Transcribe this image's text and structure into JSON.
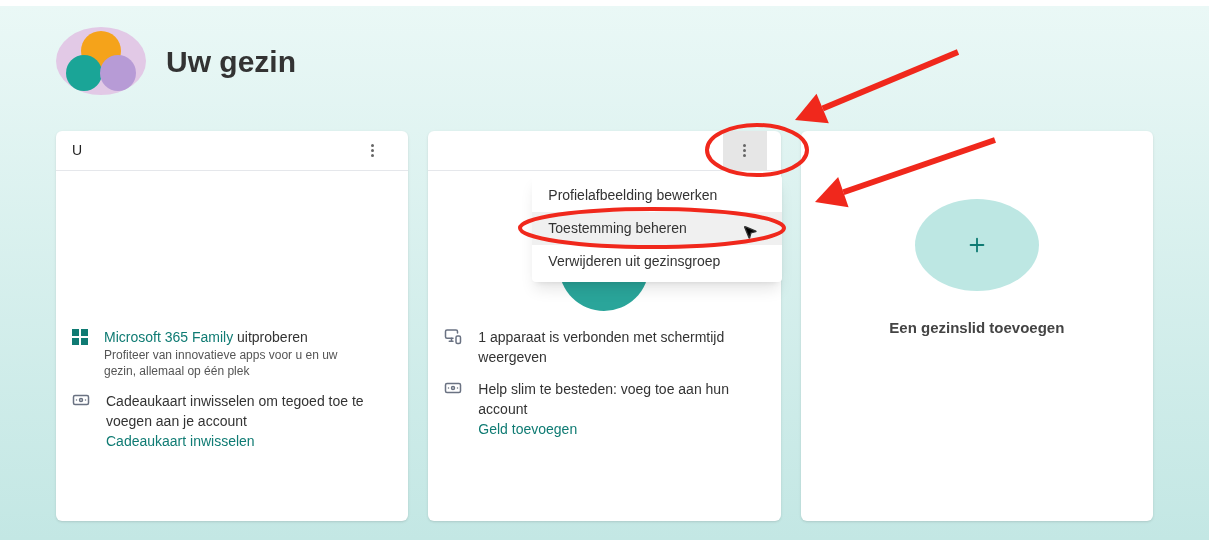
{
  "title": "Uw gezin",
  "cards": [
    {
      "kind": "member",
      "name": "U",
      "menu_active": false,
      "avatar": false,
      "items": [
        {
          "kind": "apps",
          "link": "Microsoft 365 Family",
          "text": " uitproberen",
          "description": "Profiteer van innovatieve apps voor u en uw gezin, allemaal op één plek"
        },
        {
          "kind": "gift",
          "text": "Cadeaukaart inwisselen om tegoed toe te voegen aan je account",
          "action": "Cadeaukaart inwisselen"
        }
      ]
    },
    {
      "kind": "member",
      "menu_active": true,
      "avatar": true,
      "items": [
        {
          "kind": "device",
          "text": "1 apparaat is verbonden met schermtijd weergeven"
        },
        {
          "kind": "gift",
          "text": "Help slim te besteden: voeg toe aan hun account",
          "action": "Geld toevoegen"
        }
      ],
      "menu": [
        {
          "label": "Profielafbeelding bewerken",
          "selected": false
        },
        {
          "label": "Toestemming beheren",
          "selected": true
        },
        {
          "label": "Verwijderen uit gezinsgroep",
          "selected": false
        }
      ]
    },
    {
      "kind": "add",
      "label": "Een gezinslid toevoegen"
    }
  ]
}
